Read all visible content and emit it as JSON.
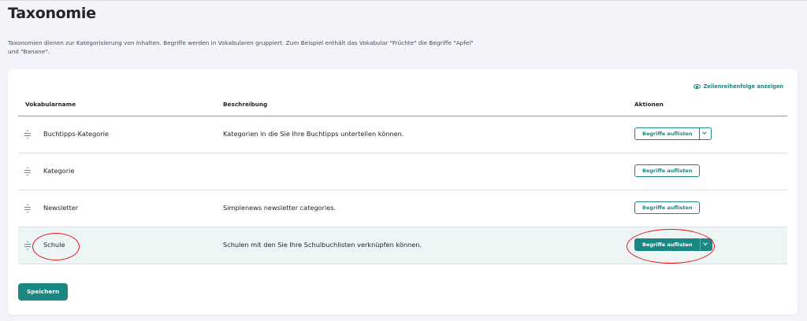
{
  "page": {
    "title": "Taxonomie",
    "intro": "Taxonomien dienen zur Kategorisierung von Inhalten. Begriffe werden in Vokabularen gruppiert. Zum Beispiel enthält das Vokabular \"Früchte\" die Begriffe \"Apfel\" und \"Banane\"."
  },
  "table": {
    "row_order_link": "Zeilenreihenfolge anzeigen",
    "headers": {
      "name": "Vokabularname",
      "description": "Beschreibung",
      "actions": "Aktionen"
    },
    "rows": [
      {
        "name": "Buchtipps-Kategorie",
        "description": "Kategorien in die Sie Ihre Buchtipps unterteilen können.",
        "action_label": "Begriffe auflisten"
      },
      {
        "name": "Kategorie",
        "description": "",
        "action_label": "Begriffe auflisten"
      },
      {
        "name": "Newsletter",
        "description": "Simplenews newsletter categories.",
        "action_label": "Begriffe auflisten"
      },
      {
        "name": "Schule",
        "description": "Schulen mit den Sie Ihre Schulbuchlisten verknüpfen können.",
        "action_label": "Begriffe auflisten"
      }
    ]
  },
  "form": {
    "save_label": "Speichern"
  },
  "icons": {
    "drag": "drag-handle-icon",
    "eye": "eye-icon",
    "dropdown": "chevron-down-icon"
  },
  "colors": {
    "accent": "#1a8783",
    "annotation": "#e8141b",
    "highlight_row": "#eef6f5"
  }
}
